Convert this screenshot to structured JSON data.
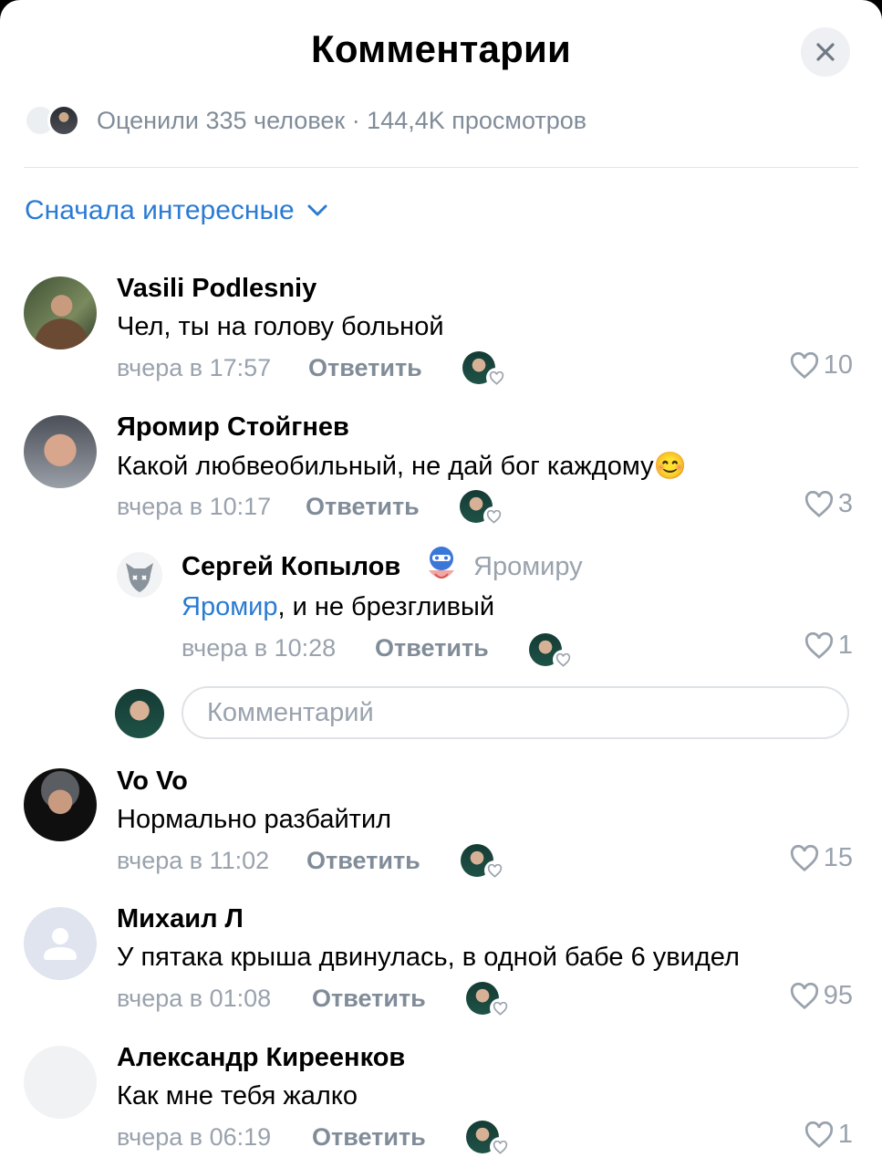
{
  "header": {
    "title": "Комментарии"
  },
  "stats": {
    "text": "Оценили 335 человек · 144,4K просмотров"
  },
  "sort": {
    "label": "Сначала интересные"
  },
  "reply_label": "Ответить",
  "comments": [
    {
      "author": "Vasili Podlesniy",
      "text": "Чел, ты на голову больной",
      "time": "вчера в 17:57",
      "likes": "10"
    },
    {
      "author": "Яромир Стойгнев",
      "text": "Какой любвеобильный, не дай бог каждому",
      "emoji": "😊",
      "time": "вчера в 10:17",
      "likes": "3"
    },
    {
      "author": "Vo Vo",
      "text": "Нормально разбайтил",
      "time": "вчера в 11:02",
      "likes": "15"
    },
    {
      "author": "Михаил Л",
      "text": "У пятака крыша двинулась, в одной бабе 6 увидел",
      "time": "вчера в 01:08",
      "likes": "95"
    },
    {
      "author": "Александр Киреенков",
      "text": "Как мне тебя жалко",
      "time": "вчера в 06:19",
      "likes": "1"
    }
  ],
  "reply_thread": {
    "author": "Сергей Копылов",
    "reply_to": "Яромиру",
    "mention": "Яромир",
    "text": ", и не брезгливый",
    "time": "вчера в 10:28",
    "likes": "1"
  },
  "comment_input": {
    "placeholder": "Комментарий"
  },
  "colors": {
    "accent": "#2a7bd3",
    "secondary_text": "#818c99"
  }
}
